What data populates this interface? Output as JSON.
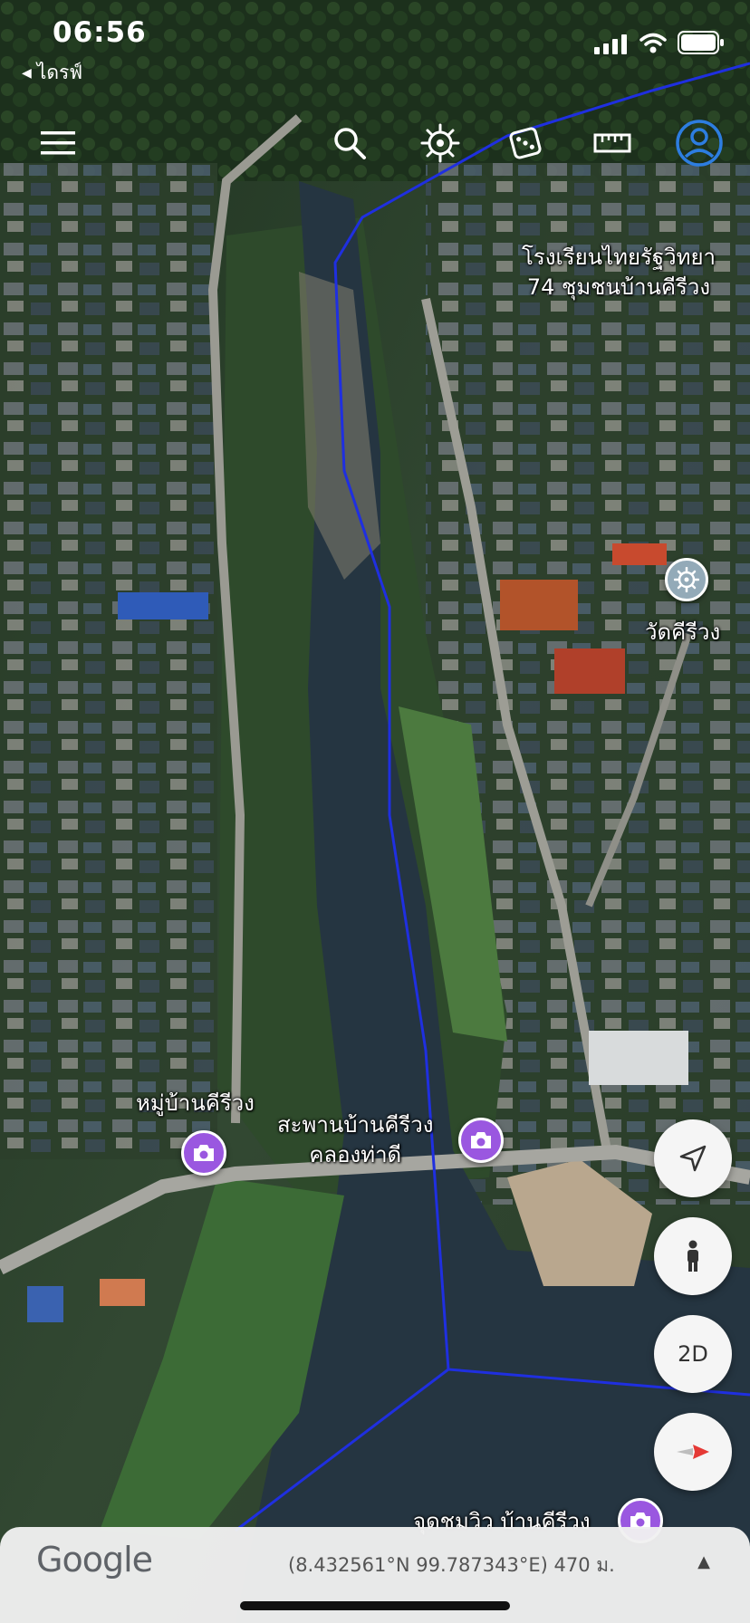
{
  "status_bar": {
    "time": "06:56",
    "back_label": "ไดรฟ์",
    "icons": [
      "signal-icon",
      "wifi-icon",
      "battery-icon"
    ]
  },
  "toolbar": {
    "items": [
      "menu-icon",
      "search-icon",
      "voyager-icon",
      "dice-icon",
      "ruler-icon",
      "account-icon"
    ]
  },
  "places": {
    "school_line1": "โรงเรียนไทยรัฐวิทยา",
    "school_line2": "74 ชุมชนบ้านคีรีวง",
    "temple": "วัดคีรีวง",
    "village": "หมู่บ้านคีรีวง",
    "bridge_line1": "สะพานบ้านคีรีวง",
    "bridge_line2": "คลองท่าดี",
    "viewpoint": "จุดชมวิว บ้านคีรีวง"
  },
  "controls": {
    "view_mode": "2D",
    "buttons": [
      "navigation-icon",
      "street-view-icon",
      "view-2d-button",
      "compass-icon"
    ]
  },
  "bottom_bar": {
    "logo": "Google",
    "coordinates": "(8.432561°N 99.787343°E) 470 ม.",
    "expand": "▲"
  },
  "colors": {
    "boundary_line": "#1f2fe0",
    "photo_pin": "#9a57e0",
    "account_icon": "#2d7de0",
    "compass_red": "#e53935"
  }
}
